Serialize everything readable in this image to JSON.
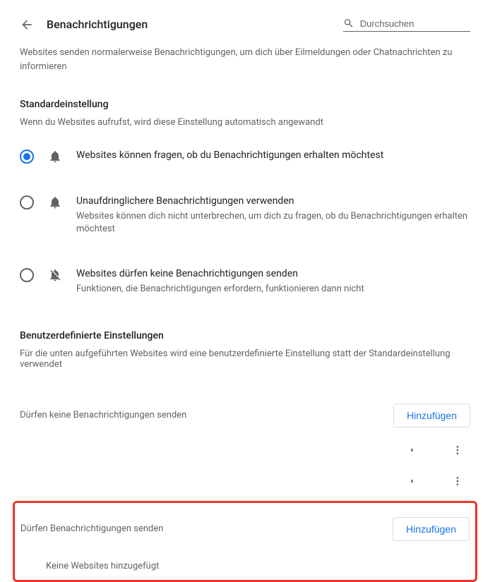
{
  "header": {
    "title": "Benachrichtigungen",
    "search_placeholder": "Durchsuchen"
  },
  "intro": "Websites senden normalerweise Benachrichtigungen, um dich über Eilmeldungen oder Chatnachrichten zu informieren",
  "default_section": {
    "title": "Standardeinstellung",
    "subtitle": "Wenn du Websites aufrufst, wird diese Einstellung automatisch angewandt",
    "options": [
      {
        "label": "Websites können fragen, ob du Benachrichtigungen erhalten möchtest",
        "desc": ""
      },
      {
        "label": "Unaufdringlichere Benachrichtigungen verwenden",
        "desc": "Websites können dich nicht unterbrechen, um dich zu fragen, ob du Benachrichtigungen erhalten möchtest"
      },
      {
        "label": "Websites dürfen keine Benachrichtigungen senden",
        "desc": "Funktionen, die Benachrichtigungen erfordern, funktionieren dann nicht"
      }
    ]
  },
  "custom_section": {
    "title": "Benutzerdefinierte Einstellungen",
    "subtitle": "Für die unten aufgeführten Websites wird eine benutzerdefinierte Einstellung statt der Standardeinstellung verwendet"
  },
  "block_list": {
    "header": "Dürfen keine Benachrichtigungen senden",
    "add_label": "Hinzufügen"
  },
  "allow_list": {
    "header": "Dürfen Benachrichtigungen senden",
    "add_label": "Hinzufügen",
    "empty": "Keine Websites hinzugefügt"
  }
}
